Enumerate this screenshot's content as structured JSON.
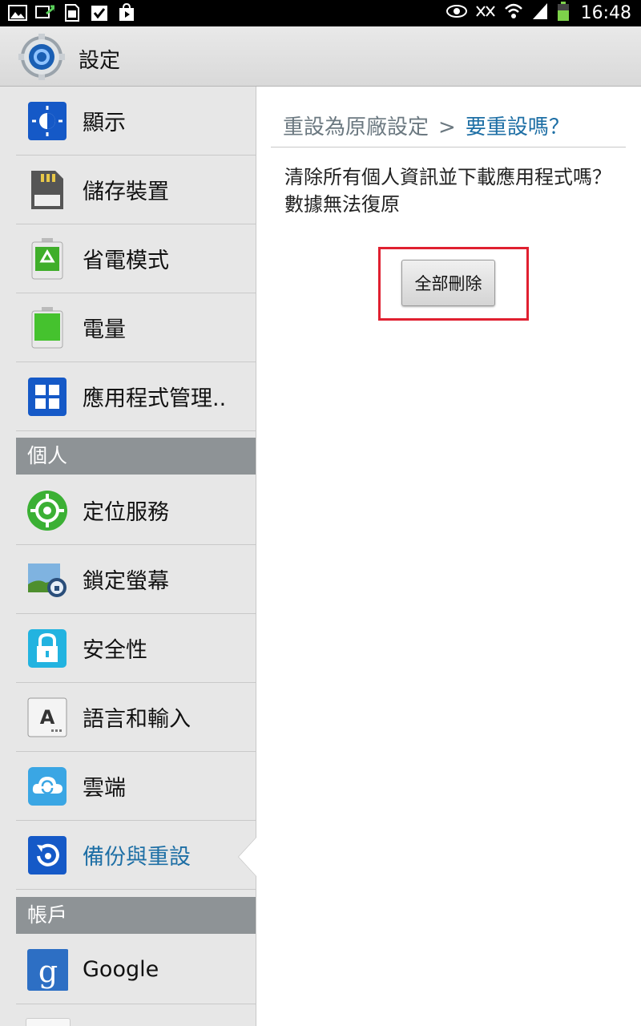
{
  "status_bar": {
    "time": "16:48",
    "left_icons": [
      "gallery-icon",
      "screen-mirror-icon",
      "sim-icon",
      "checkbox-icon",
      "play-store-icon"
    ],
    "right_icons": [
      "smart-stay-eye-icon",
      "nfc-icon",
      "wifi-icon",
      "signal-icon",
      "battery-icon"
    ]
  },
  "action_bar": {
    "title": "設定",
    "icon": "settings-gear-icon"
  },
  "sidebar": {
    "items": [
      {
        "label": "顯示",
        "icon": "display-icon"
      },
      {
        "label": "儲存裝置",
        "icon": "storage-icon"
      },
      {
        "label": "省電模式",
        "icon": "power-saving-icon"
      },
      {
        "label": "電量",
        "icon": "battery-icon"
      },
      {
        "label": "應用程式管理..",
        "icon": "app-manager-icon"
      }
    ],
    "section_personal": "個人",
    "personal_items": [
      {
        "label": "定位服務",
        "icon": "location-icon"
      },
      {
        "label": "鎖定螢幕",
        "icon": "lock-screen-icon"
      },
      {
        "label": "安全性",
        "icon": "security-lock-icon"
      },
      {
        "label": "語言和輸入",
        "icon": "language-input-icon"
      },
      {
        "label": "雲端",
        "icon": "cloud-sync-icon"
      },
      {
        "label": "備份與重設",
        "icon": "backup-reset-icon"
      }
    ],
    "section_accounts": "帳戶",
    "account_items": [
      {
        "label": "Google",
        "icon": "google-icon"
      }
    ]
  },
  "main": {
    "breadcrumb_parent": "重設為原廠設定",
    "breadcrumb_separator": ">",
    "breadcrumb_current": "要重設嗎？",
    "description": "清除所有個人資訊並下載應用程式嗎？數據無法復原",
    "delete_all_button": "全部刪除"
  },
  "colors": {
    "accent": "#1e6fa5",
    "highlight": "#e02030",
    "section_header": "#8e9396"
  }
}
